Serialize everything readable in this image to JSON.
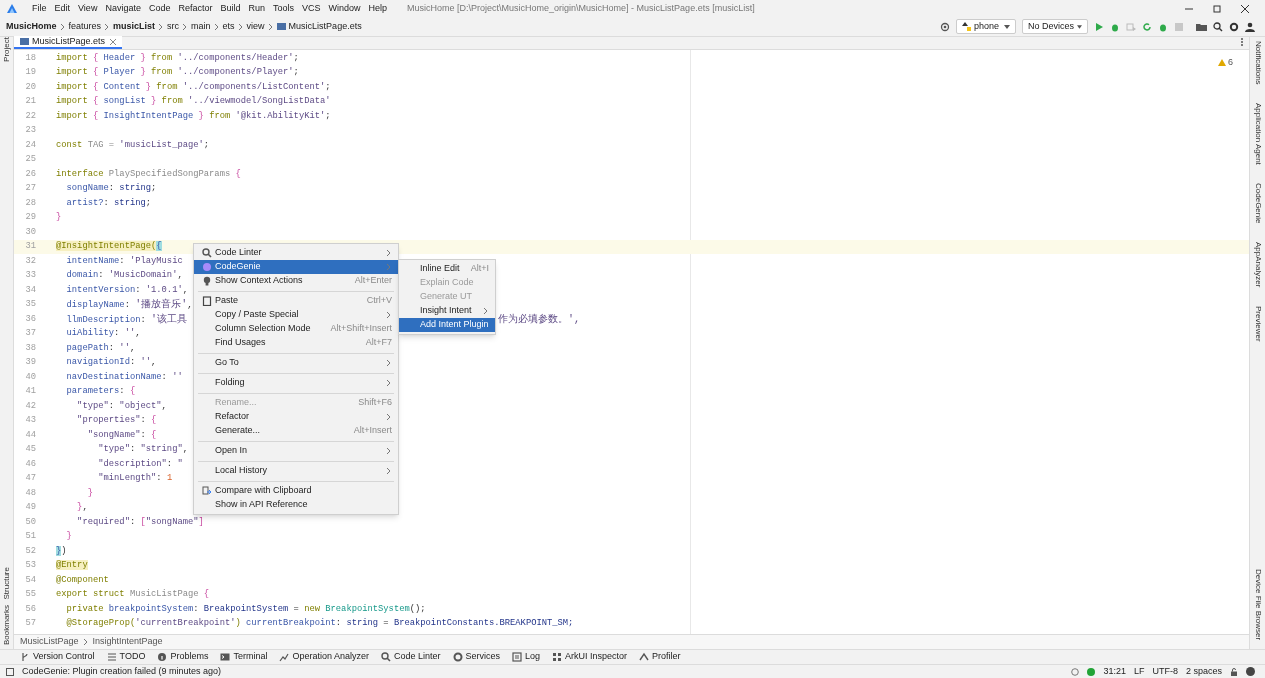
{
  "window": {
    "title": "MusicHome [D:\\Project\\MusicHome_origin\\MusicHome] - MusicListPage.ets [musicList]"
  },
  "menu_bar": [
    "File",
    "Edit",
    "View",
    "Navigate",
    "Code",
    "Refactor",
    "Build",
    "Run",
    "Tools",
    "VCS",
    "Window",
    "Help"
  ],
  "nav_bar": {
    "crumbs": [
      {
        "label": "MusicHome",
        "bold": true
      },
      {
        "label": "features",
        "bold": false
      },
      {
        "label": "musicList",
        "bold": true
      },
      {
        "label": "src",
        "bold": false
      },
      {
        "label": "main",
        "bold": false
      },
      {
        "label": "ets",
        "bold": false
      },
      {
        "label": "view",
        "bold": false
      },
      {
        "label": "MusicListPage.ets",
        "bold": false
      }
    ],
    "device": "phone",
    "target": "No Devices"
  },
  "left_tools": {
    "top": [
      "Project"
    ],
    "bottom": [
      "Structure",
      "Bookmarks"
    ]
  },
  "right_tools": [
    "Notifications",
    "Application Agent",
    "CodeGenie",
    "AppAnalyzer",
    "Previewer",
    "Device File Browser"
  ],
  "tab": {
    "label": "MusicListPage.ets",
    "selected": true
  },
  "warnings": "6",
  "code": [
    {
      "n": "18",
      "tokens": [
        {
          "text": "import",
          "kind": "kw"
        },
        {
          "text": " { ",
          "kind": "br"
        },
        {
          "text": "Header",
          "kind": "id"
        },
        {
          "text": " } ",
          "kind": "br"
        },
        {
          "text": "from",
          "kind": "kw"
        },
        {
          "text": " '../components/Header'",
          "kind": "str"
        },
        {
          "text": ";",
          "kind": "pl"
        }
      ]
    },
    {
      "n": "19",
      "tokens": [
        {
          "text": "import",
          "kind": "kw"
        },
        {
          "text": " { ",
          "kind": "br"
        },
        {
          "text": "Player",
          "kind": "id"
        },
        {
          "text": " } ",
          "kind": "br"
        },
        {
          "text": "from",
          "kind": "kw"
        },
        {
          "text": " '../components/Player'",
          "kind": "str"
        },
        {
          "text": ";",
          "kind": "pl"
        }
      ]
    },
    {
      "n": "20",
      "tokens": [
        {
          "text": "import",
          "kind": "kw"
        },
        {
          "text": " { ",
          "kind": "br"
        },
        {
          "text": "Content",
          "kind": "id"
        },
        {
          "text": " } ",
          "kind": "br"
        },
        {
          "text": "from",
          "kind": "kw"
        },
        {
          "text": " '../components/ListContent'",
          "kind": "str"
        },
        {
          "text": ";",
          "kind": "pl"
        }
      ]
    },
    {
      "n": "21",
      "tokens": [
        {
          "text": "import",
          "kind": "kw"
        },
        {
          "text": " { ",
          "kind": "br"
        },
        {
          "text": "songList",
          "kind": "id"
        },
        {
          "text": " } ",
          "kind": "br"
        },
        {
          "text": "from",
          "kind": "kw"
        },
        {
          "text": " '../viewmodel/SongListData'",
          "kind": "str"
        }
      ]
    },
    {
      "n": "22",
      "tokens": [
        {
          "text": "import",
          "kind": "kw"
        },
        {
          "text": " { ",
          "kind": "br"
        },
        {
          "text": "InsightIntentPage",
          "kind": "id"
        },
        {
          "text": " } ",
          "kind": "br"
        },
        {
          "text": "from",
          "kind": "kw"
        },
        {
          "text": " '@kit.AbilityKit'",
          "kind": "str"
        },
        {
          "text": ";",
          "kind": "pl"
        }
      ]
    },
    {
      "n": "23"
    },
    {
      "n": "24",
      "tokens": [
        {
          "text": "const",
          "kind": "kw"
        },
        {
          "text": " TAG = ",
          "kind": "gray"
        },
        {
          "text": "'musicList_page'",
          "kind": "str"
        },
        {
          "text": ";",
          "kind": "pl"
        }
      ]
    },
    {
      "n": "25"
    },
    {
      "n": "26",
      "tokens": [
        {
          "text": "interface",
          "kind": "kw"
        },
        {
          "text": " PlaySpecifiedSongParams ",
          "kind": "gray"
        },
        {
          "text": "{",
          "kind": "br"
        }
      ]
    },
    {
      "n": "27",
      "tokens": [
        {
          "text": "  songName",
          "kind": "prop"
        },
        {
          "text": ": ",
          "kind": "pl"
        },
        {
          "text": "string",
          "kind": "type"
        },
        {
          "text": ";",
          "kind": "pl"
        }
      ]
    },
    {
      "n": "28",
      "tokens": [
        {
          "text": "  artist?",
          "kind": "prop"
        },
        {
          "text": ": ",
          "kind": "pl"
        },
        {
          "text": "string",
          "kind": "type"
        },
        {
          "text": ";",
          "kind": "pl"
        }
      ]
    },
    {
      "n": "29",
      "tokens": [
        {
          "text": "}",
          "kind": "br"
        }
      ]
    },
    {
      "n": "30"
    },
    {
      "n": "31",
      "current": true,
      "tokens": [
        {
          "text": "@InsightIntentPage(",
          "kind": "deco"
        },
        {
          "text": "{",
          "kind": "match"
        }
      ]
    },
    {
      "n": "32",
      "tokens": [
        {
          "text": "  intentName",
          "kind": "prop"
        },
        {
          "text": ": ",
          "kind": "pl"
        },
        {
          "text": "'PlayMusic",
          "kind": "str"
        }
      ]
    },
    {
      "n": "33",
      "tokens": [
        {
          "text": "  domain",
          "kind": "prop"
        },
        {
          "text": ": ",
          "kind": "pl"
        },
        {
          "text": "'MusicDomain'",
          "kind": "str"
        },
        {
          "text": ",",
          "kind": "pl"
        }
      ]
    },
    {
      "n": "34",
      "tokens": [
        {
          "text": "  intentVersion",
          "kind": "prop"
        },
        {
          "text": ": ",
          "kind": "pl"
        },
        {
          "text": "'1.0.1'",
          "kind": "str"
        },
        {
          "text": ",",
          "kind": "pl"
        }
      ]
    },
    {
      "n": "35",
      "tokens": [
        {
          "text": "  displayName",
          "kind": "prop"
        },
        {
          "text": ": ",
          "kind": "pl"
        },
        {
          "text": "'播放音乐'",
          "kind": "str"
        },
        {
          "text": ",",
          "kind": "pl"
        }
      ]
    },
    {
      "n": "36",
      "tokens": [
        {
          "text": "  llmDescription",
          "kind": "prop"
        },
        {
          "text": ": ",
          "kind": "pl"
        },
        {
          "text": "'该工具",
          "kind": "str"
        }
      ],
      "tail": "作为必填参数。',"
    },
    {
      "n": "37",
      "tokens": [
        {
          "text": "  uiAbility",
          "kind": "prop"
        },
        {
          "text": ": ",
          "kind": "pl"
        },
        {
          "text": "''",
          "kind": "str"
        },
        {
          "text": ",",
          "kind": "pl"
        }
      ]
    },
    {
      "n": "38",
      "tokens": [
        {
          "text": "  pagePath",
          "kind": "prop"
        },
        {
          "text": ": ",
          "kind": "pl"
        },
        {
          "text": "''",
          "kind": "str"
        },
        {
          "text": ",",
          "kind": "pl"
        }
      ]
    },
    {
      "n": "39",
      "tokens": [
        {
          "text": "  navigationId",
          "kind": "prop"
        },
        {
          "text": ": ",
          "kind": "pl"
        },
        {
          "text": "''",
          "kind": "str"
        },
        {
          "text": ",",
          "kind": "pl"
        }
      ]
    },
    {
      "n": "40",
      "tokens": [
        {
          "text": "  navDestinationName",
          "kind": "prop"
        },
        {
          "text": ": ",
          "kind": "pl"
        },
        {
          "text": "''",
          "kind": "str"
        }
      ]
    },
    {
      "n": "41",
      "tokens": [
        {
          "text": "  parameters",
          "kind": "prop"
        },
        {
          "text": ": ",
          "kind": "pl"
        },
        {
          "text": "{",
          "kind": "br"
        }
      ]
    },
    {
      "n": "42",
      "tokens": [
        {
          "text": "    \"type\"",
          "kind": "str"
        },
        {
          "text": ": ",
          "kind": "pl"
        },
        {
          "text": "\"object\"",
          "kind": "str"
        },
        {
          "text": ",",
          "kind": "pl"
        }
      ]
    },
    {
      "n": "43",
      "tokens": [
        {
          "text": "    \"properties\"",
          "kind": "str"
        },
        {
          "text": ": ",
          "kind": "pl"
        },
        {
          "text": "{",
          "kind": "br"
        }
      ]
    },
    {
      "n": "44",
      "tokens": [
        {
          "text": "      \"songName\"",
          "kind": "str"
        },
        {
          "text": ": ",
          "kind": "pl"
        },
        {
          "text": "{",
          "kind": "br"
        }
      ]
    },
    {
      "n": "45",
      "tokens": [
        {
          "text": "        \"type\"",
          "kind": "str"
        },
        {
          "text": ": ",
          "kind": "pl"
        },
        {
          "text": "\"string\"",
          "kind": "str"
        },
        {
          "text": ",",
          "kind": "pl"
        }
      ]
    },
    {
      "n": "46",
      "tokens": [
        {
          "text": "        \"description\"",
          "kind": "str"
        },
        {
          "text": ": ",
          "kind": "pl"
        },
        {
          "text": "\"",
          "kind": "str"
        }
      ]
    },
    {
      "n": "47",
      "tokens": [
        {
          "text": "        \"minLength\"",
          "kind": "str"
        },
        {
          "text": ": ",
          "kind": "pl"
        },
        {
          "text": "1",
          "kind": "num"
        }
      ]
    },
    {
      "n": "48",
      "tokens": [
        {
          "text": "      }",
          "kind": "br"
        }
      ]
    },
    {
      "n": "49",
      "tokens": [
        {
          "text": "    }",
          "kind": "br"
        },
        {
          "text": ",",
          "kind": "pl"
        }
      ]
    },
    {
      "n": "50",
      "tokens": [
        {
          "text": "    \"required\"",
          "kind": "str"
        },
        {
          "text": ": ",
          "kind": "pl"
        },
        {
          "text": "[",
          "kind": "br"
        },
        {
          "text": "\"songName\"",
          "kind": "str"
        },
        {
          "text": "]",
          "kind": "br"
        }
      ]
    },
    {
      "n": "51",
      "tokens": [
        {
          "text": "  }",
          "kind": "br"
        }
      ]
    },
    {
      "n": "52",
      "tokens": [
        {
          "text": "}",
          "kind": "match"
        },
        {
          "text": ")",
          "kind": "pl"
        }
      ]
    },
    {
      "n": "53",
      "tokens": [
        {
          "text": "@Entry",
          "kind": "deco"
        }
      ]
    },
    {
      "n": "54",
      "tokens": [
        {
          "text": "@Component",
          "kind": "kw"
        }
      ]
    },
    {
      "n": "55",
      "tokens": [
        {
          "text": "export struct",
          "kind": "kw"
        },
        {
          "text": " MusicListPage ",
          "kind": "gray"
        },
        {
          "text": "{",
          "kind": "br"
        }
      ]
    },
    {
      "n": "56",
      "tokens": [
        {
          "text": "  private",
          "kind": "kw"
        },
        {
          "text": " breakpointSystem",
          "kind": "prop"
        },
        {
          "text": ": ",
          "kind": "pl"
        },
        {
          "text": "BreakpointSystem",
          "kind": "type"
        },
        {
          "text": " = ",
          "kind": "pl"
        },
        {
          "text": "new",
          "kind": "kw"
        },
        {
          "text": " BreakpointSystem",
          "kind": "call"
        },
        {
          "text": "();",
          "kind": "pl"
        }
      ]
    },
    {
      "n": "57",
      "tokens": [
        {
          "text": "  @StorageProp(",
          "kind": "kw"
        },
        {
          "text": "'currentBreakpoint'",
          "kind": "str"
        },
        {
          "text": ") ",
          "kind": "kw"
        },
        {
          "text": "currentBreakpoint",
          "kind": "prop"
        },
        {
          "text": ": ",
          "kind": "pl"
        },
        {
          "text": "string",
          "kind": "type"
        },
        {
          "text": " = ",
          "kind": "pl"
        },
        {
          "text": "BreakpointConstants",
          "kind": "type"
        },
        {
          "text": ".BREAKPOINT_SM;",
          "kind": "type"
        }
      ]
    }
  ],
  "context_menu": [
    {
      "kind": "item",
      "label": "Code Linter",
      "submenu": true,
      "selected": false,
      "disabled": false
    },
    {
      "kind": "item",
      "label": "CodeGenie",
      "submenu": true,
      "selected": true,
      "disabled": false
    },
    {
      "kind": "item",
      "label": "Show Context Actions",
      "shortcut": "Alt+Enter",
      "submenu": false,
      "selected": false,
      "disabled": false
    },
    {
      "kind": "separator"
    },
    {
      "kind": "item",
      "label": "Paste",
      "shortcut": "Ctrl+V",
      "submenu": false,
      "selected": false,
      "disabled": false
    },
    {
      "kind": "item",
      "label": "Copy / Paste Special",
      "submenu": true,
      "selected": false,
      "disabled": false
    },
    {
      "kind": "item",
      "label": "Column Selection Mode",
      "shortcut": "Alt+Shift+Insert",
      "submenu": false,
      "selected": false,
      "disabled": false
    },
    {
      "kind": "item",
      "label": "Find Usages",
      "shortcut": "Alt+F7",
      "submenu": false,
      "selected": false,
      "disabled": false
    },
    {
      "kind": "separator"
    },
    {
      "kind": "item",
      "label": "Go To",
      "submenu": true,
      "selected": false,
      "disabled": false
    },
    {
      "kind": "separator"
    },
    {
      "kind": "item",
      "label": "Folding",
      "submenu": true,
      "selected": false,
      "disabled": false
    },
    {
      "kind": "separator"
    },
    {
      "kind": "item",
      "label": "Rename...",
      "shortcut": "Shift+F6",
      "submenu": false,
      "selected": false,
      "disabled": true
    },
    {
      "kind": "item",
      "label": "Refactor",
      "submenu": true,
      "selected": false,
      "disabled": false
    },
    {
      "kind": "item",
      "label": "Generate...",
      "shortcut": "Alt+Insert",
      "submenu": false,
      "selected": false,
      "disabled": false
    },
    {
      "kind": "separator"
    },
    {
      "kind": "item",
      "label": "Open In",
      "submenu": true,
      "selected": false,
      "disabled": false
    },
    {
      "kind": "separator"
    },
    {
      "kind": "item",
      "label": "Local History",
      "submenu": true,
      "selected": false,
      "disabled": false
    },
    {
      "kind": "separator"
    },
    {
      "kind": "item",
      "label": "Compare with Clipboard",
      "submenu": false,
      "selected": false,
      "disabled": false
    },
    {
      "kind": "item",
      "label": "Show in API Reference",
      "submenu": false,
      "selected": false,
      "disabled": false
    }
  ],
  "submenu": [
    {
      "label": "Inline Edit",
      "shortcut": "Alt+I",
      "submenu": false,
      "selected": false,
      "disabled": false
    },
    {
      "label": "Explain Code",
      "submenu": false,
      "selected": false,
      "disabled": true
    },
    {
      "label": "Generate UT",
      "submenu": false,
      "selected": false,
      "disabled": true
    },
    {
      "label": "Insight Intent",
      "submenu": true,
      "selected": false,
      "disabled": false
    },
    {
      "label": "Add Intent Plugin",
      "submenu": false,
      "selected": true,
      "disabled": false
    }
  ],
  "breadcrumb": [
    "MusicListPage",
    "InsightIntentPage"
  ],
  "tool_windows": [
    "Version Control",
    "TODO",
    "Problems",
    "Terminal",
    "Operation Analyzer",
    "Code Linter",
    "Services",
    "Log",
    "ArkUI Inspector",
    "Profiler"
  ],
  "status_bar": {
    "message": "CodeGenie: Plugin creation failed (9 minutes ago)",
    "position": "31:21",
    "line_ending": "LF",
    "encoding": "UTF-8",
    "indent": "2 spaces"
  }
}
